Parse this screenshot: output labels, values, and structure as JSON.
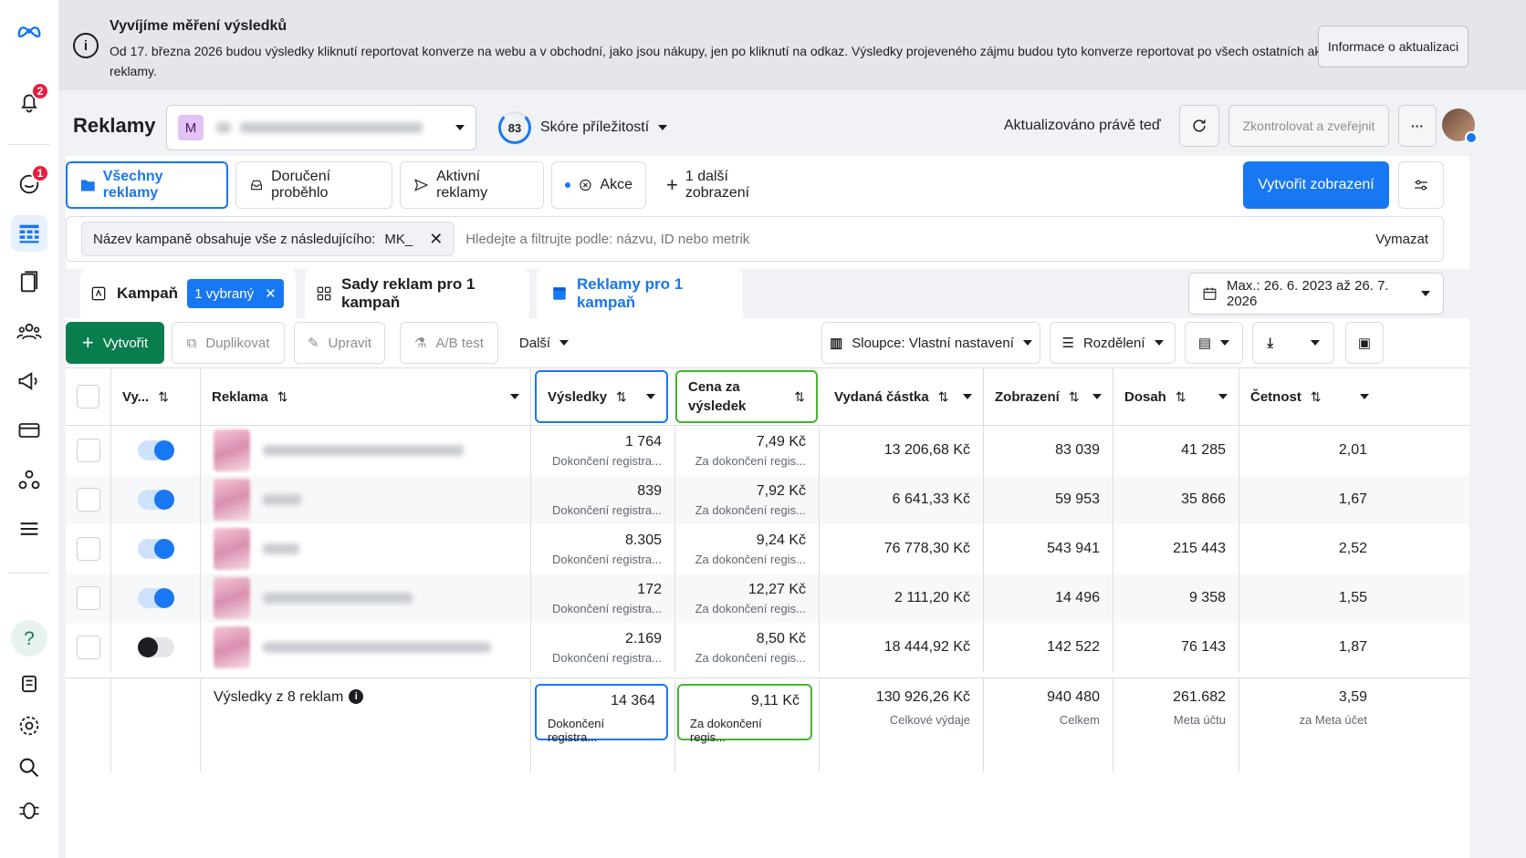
{
  "banner": {
    "title": "Vyvíjíme měření výsledků",
    "text": "Od 17. března 2026 budou výsledky kliknutí reportovat konverze na webu a v obchodní, jako jsou nákupy, jen po kliknutí na odkaz. Výsledky projeveného zájmu budou tyto konverze reportovat po všech ostatních akcích reklamy.",
    "button": "Informace o aktualizaci"
  },
  "sidebar": {
    "notifications_badge": "2",
    "messages_badge": "1"
  },
  "header": {
    "title": "Reklamy",
    "account_initial": "M",
    "score_value": "83",
    "score_label": "Skóre příležitostí",
    "updated": "Aktualizováno právě teď",
    "review_button": "Zkontrolovat a zveřejnit",
    "more_button": "···"
  },
  "view_tabs": [
    {
      "label": "Všechny reklamy"
    },
    {
      "label": "Doručení proběhlo"
    },
    {
      "label": "Aktivní reklamy"
    },
    {
      "label": "Akce"
    },
    {
      "label": "1 další zobrazení"
    }
  ],
  "create_view_button": "Vytvořit zobrazení",
  "filter": {
    "chip_label": "Název kampaně obsahuje vše z následujícího:",
    "chip_value": "MK_",
    "placeholder": "Hledejte a filtrujte podle: názvu, ID nebo metrik",
    "clear": "Vymazat"
  },
  "levels": {
    "campaign": "Kampaň",
    "selected": "1 vybraný",
    "adsets": "Sady reklam pro 1 kampaň",
    "ads": "Reklamy pro 1 kampaň"
  },
  "date_range": "Max.: 26. 6. 2023 až 26. 7. 2026",
  "toolbar": {
    "create": "Vytvořit",
    "duplicate": "Duplikovat",
    "edit": "Upravit",
    "abtest": "A/B test",
    "more": "Další",
    "columns": "Sloupce: Vlastní nastavení",
    "breakdown": "Rozdělení"
  },
  "table": {
    "headers": {
      "delivery": "Vy...",
      "ad": "Reklama",
      "results": "Výsledky",
      "cost_per_result_1": "Cena za",
      "cost_per_result_2": "výsledek",
      "spent": "Vydaná částka",
      "impressions": "Zobrazení",
      "reach": "Dosah",
      "frequency": "Četnost"
    },
    "rows": [
      {
        "on": true,
        "results": "1 764",
        "results_sub": "Dokončení registra...",
        "cpr": "7,49 Kč",
        "cpr_sub": "Za dokončení regis...",
        "spent": "13 206,68 Kč",
        "impressions": "83 039",
        "reach": "41 285",
        "frequency": "2,01"
      },
      {
        "on": true,
        "results": "839",
        "results_sub": "Dokončení registra...",
        "cpr": "7,92 Kč",
        "cpr_sub": "Za dokončení regis...",
        "spent": "6 641,33 Kč",
        "impressions": "59 953",
        "reach": "35 866",
        "frequency": "1,67"
      },
      {
        "on": true,
        "results": "8.305",
        "results_sub": "Dokončení registra...",
        "cpr": "9,24 Kč",
        "cpr_sub": "Za dokončení regis...",
        "spent": "76 778,30 Kč",
        "impressions": "543 941",
        "reach": "215 443",
        "frequency": "2,52"
      },
      {
        "on": true,
        "results": "172",
        "results_sub": "Dokončení registra...",
        "cpr": "12,27 Kč",
        "cpr_sub": "Za dokončení regis...",
        "spent": "2 111,20 Kč",
        "impressions": "14 496",
        "reach": "9 358",
        "frequency": "1,55"
      },
      {
        "on": false,
        "results": "2.169",
        "results_sub": "Dokončení registra...",
        "cpr": "8,50 Kč",
        "cpr_sub": "Za dokončení regis...",
        "spent": "18 444,92 Kč",
        "impressions": "142 522",
        "reach": "76 143",
        "frequency": "1,87"
      }
    ],
    "totals": {
      "label": "Výsledky z 8 reklam",
      "results": "14 364",
      "results_sub": "Dokončení registra...",
      "cpr": "9,11 Kč",
      "cpr_sub": "Za dokončení regis...",
      "spent": "130 926,26 Kč",
      "spent_sub": "Celkové výdaje",
      "impressions": "940 480",
      "impressions_sub": "Celkem",
      "reach": "261.682",
      "reach_sub": "Meta účtu",
      "frequency": "3,59",
      "frequency_sub": "za Meta účet"
    }
  }
}
